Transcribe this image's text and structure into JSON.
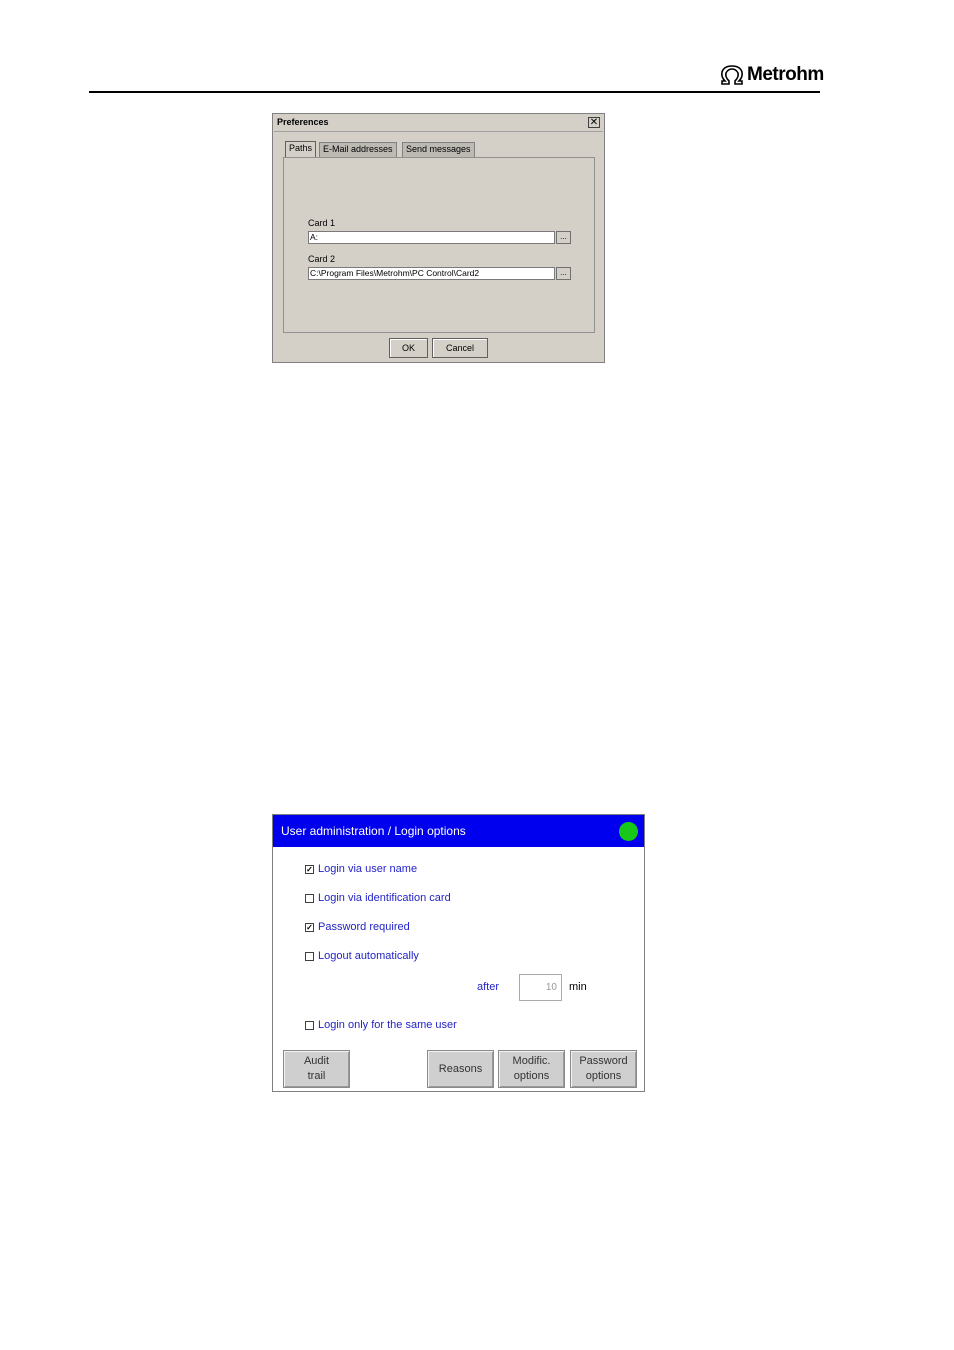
{
  "header": {
    "brand": "Metrohm",
    "logo_icon": "omega-arch-icon"
  },
  "preferences_dialog": {
    "title": "Preferences",
    "close_glyph": "✕",
    "tabs": [
      {
        "label": "Paths",
        "active": true
      },
      {
        "label": "E-Mail addresses",
        "active": false
      },
      {
        "label": "Send messages",
        "active": false
      }
    ],
    "card1_label": "Card 1",
    "card1_value": "A:",
    "card2_label": "Card 2",
    "card2_value": "C:\\Program Files\\Metrohm\\PC Control\\Card2",
    "browse_label": "...",
    "ok_label": "OK",
    "cancel_label": "Cancel"
  },
  "login_dialog": {
    "title": "User administration / Login options",
    "status_color": "#18c818",
    "options": [
      {
        "label": "Login via user name",
        "checked": true
      },
      {
        "label": "Login via identification card",
        "checked": false
      },
      {
        "label": "Password required",
        "checked": true
      },
      {
        "label": "Logout automatically",
        "checked": false
      },
      {
        "label": "Login only for the same user",
        "checked": false
      }
    ],
    "after_label": "after",
    "logout_minutes": "10",
    "unit_label": "min",
    "buttons": {
      "audit_trail": "Audit\ntrail",
      "reasons": "Reasons",
      "modific_options": "Modific.\noptions",
      "password_options": "Password\noptions"
    }
  }
}
